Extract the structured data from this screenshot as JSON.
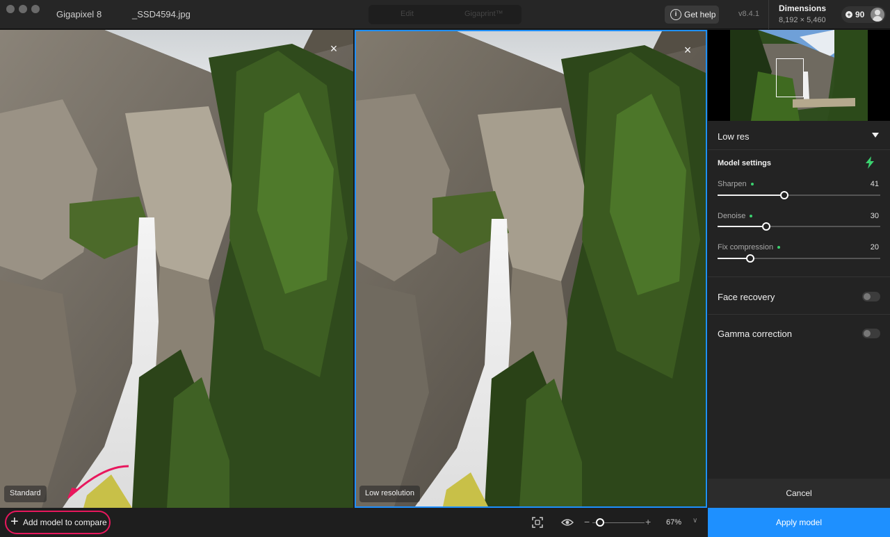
{
  "titlebar": {
    "app_name": "Gigapixel",
    "app_version": "8",
    "file_name": "_SSD4594.jpg",
    "tabs": [
      "Edit",
      "Gigaprint™"
    ],
    "help_label": "Get help",
    "version": "v8.4.1",
    "dimensions_title": "Dimensions",
    "dimensions_value": "8,192 × 5,460",
    "credits": "90"
  },
  "preview": {
    "left_label": "Standard",
    "right_label": "Low resolution"
  },
  "bottombar": {
    "add_model_label": "Add model to compare",
    "zoom_value": "67%",
    "zoom_level": 0.15
  },
  "panel": {
    "model_name": "Low res",
    "model_settings_title": "Model settings",
    "sliders": [
      {
        "label": "Sharpen",
        "value": "41",
        "fraction": 0.41
      },
      {
        "label": "Denoise",
        "value": "30",
        "fraction": 0.3
      },
      {
        "label": "Fix compression",
        "value": "20",
        "fraction": 0.2
      }
    ],
    "face_recovery_label": "Face recovery",
    "gamma_correction_label": "Gamma correction",
    "cancel_label": "Cancel",
    "apply_label": "Apply model"
  },
  "colors": {
    "accent": "#1e90ff",
    "highlight": "#e8175d",
    "active_dot": "#3bd16f"
  }
}
